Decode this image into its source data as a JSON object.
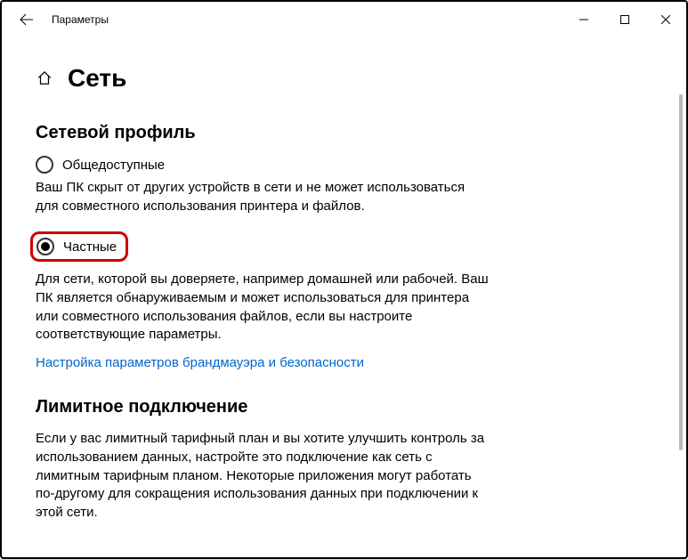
{
  "window": {
    "title": "Параметры"
  },
  "page": {
    "title": "Сеть"
  },
  "profile": {
    "heading": "Сетевой профиль",
    "public": {
      "label": "Общедоступные",
      "desc": "Ваш ПК скрыт от других устройств в сети и не может использоваться для совместного использования принтера и файлов."
    },
    "private": {
      "label": "Частные",
      "desc": "Для сети, которой вы доверяете, например домашней или рабочей. Ваш ПК является обнаруживаемым и может использоваться для принтера или совместного использования файлов, если вы настроите соответствующие параметры."
    },
    "firewall_link": "Настройка параметров брандмауэра и безопасности"
  },
  "metered": {
    "heading": "Лимитное подключение",
    "desc": "Если у вас лимитный тарифный план и вы хотите улучшить контроль за использованием данных, настройте это подключение как сеть с лимитным тарифным планом. Некоторые приложения могут работать по-другому для сокращения использования данных при подключении к этой сети."
  }
}
